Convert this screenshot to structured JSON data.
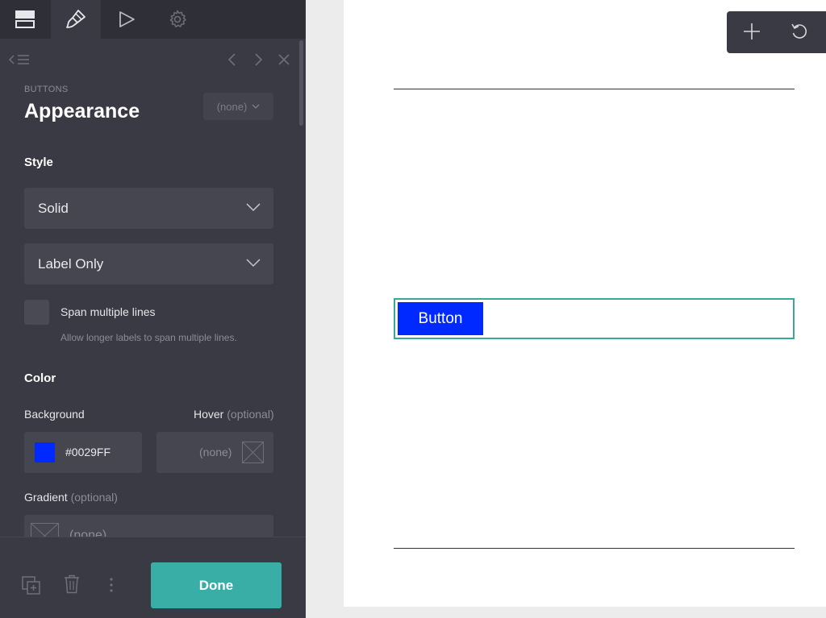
{
  "sidebar": {
    "tabs": [
      {
        "icon": "layout-icon"
      },
      {
        "icon": "paintbrush-icon"
      },
      {
        "icon": "play-icon"
      },
      {
        "icon": "gear-icon"
      }
    ],
    "section_label": "BUTTONS",
    "title": "Appearance",
    "preset_value": "(none)",
    "style_heading": "Style",
    "style_select_value": "Solid",
    "content_select_value": "Label Only",
    "span_lines": {
      "label": "Span multiple lines",
      "help": "Allow longer labels to span multiple lines.",
      "checked": false
    },
    "color_heading": "Color",
    "background": {
      "label": "Background",
      "value": "#0029FF",
      "color": "#0029FF"
    },
    "hover": {
      "label": "Hover",
      "optional": "(optional)",
      "value": "(none)"
    },
    "gradient": {
      "label": "Gradient",
      "optional": "(optional)",
      "value": "(none)"
    },
    "footer": {
      "done_label": "Done"
    }
  },
  "canvas": {
    "button_label": "Button",
    "button_color": "#0029FF",
    "selection_color": "#3aa79c"
  },
  "toolbar": {
    "icons": [
      "plus-icon",
      "undo-icon"
    ]
  }
}
